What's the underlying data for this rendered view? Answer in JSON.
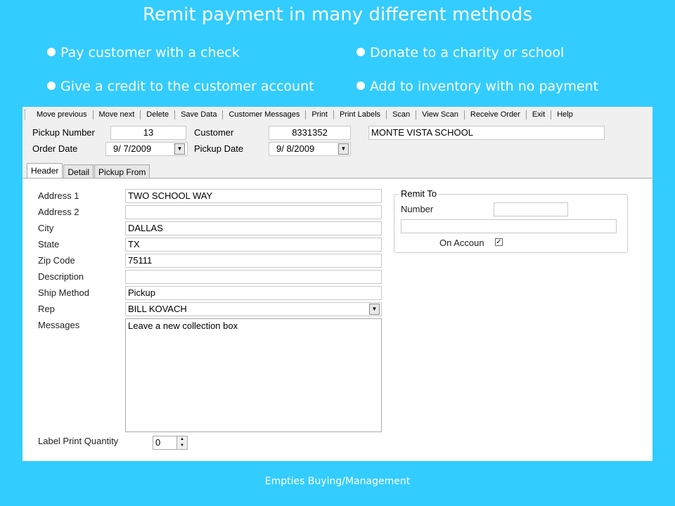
{
  "slide": {
    "title": "Remit payment in many different methods",
    "bullets": [
      "Pay customer with a check",
      "Donate to a charity or school",
      "Give a credit to the customer account",
      "Add to inventory with no payment"
    ],
    "footer": "Empties Buying/Management"
  },
  "toolbar": [
    "Move previous",
    "Move next",
    "Delete",
    "Save Data",
    "Customer Messages",
    "Print",
    "Print Labels",
    "Scan",
    "View Scan",
    "Receive Order",
    "Exit",
    "Help"
  ],
  "top": {
    "pickup_number_label": "Pickup Number",
    "pickup_number": "13",
    "customer_label": "Customer",
    "customer_number": "8331352",
    "customer_name": "MONTE VISTA SCHOOL",
    "order_date_label": "Order Date",
    "order_date": "9/  7/2009",
    "pickup_date_label": "Pickup Date",
    "pickup_date": "9/  8/2009"
  },
  "tabs": [
    "Header",
    "Detail",
    "Pickup From"
  ],
  "header": {
    "address1_label": "Address 1",
    "address1": "TWO SCHOOL WAY",
    "address2_label": "Address 2",
    "address2": "",
    "city_label": "City",
    "city": "DALLAS",
    "state_label": "State",
    "state": "TX",
    "zip_label": "Zip Code",
    "zip": "75111",
    "description_label": "Description",
    "description": "",
    "ship_method_label": "Ship Method",
    "ship_method": "Pickup",
    "rep_label": "Rep",
    "rep": "BILL KOVACH",
    "messages_label": "Messages",
    "messages": "Leave a new collection box",
    "label_qty_label": "Label Print Quantity",
    "label_qty": "0"
  },
  "remit": {
    "legend": "Remit To",
    "number_label": "Number",
    "number": "",
    "extra": "",
    "on_account_label": "On Accoun",
    "on_account_checked": true
  }
}
